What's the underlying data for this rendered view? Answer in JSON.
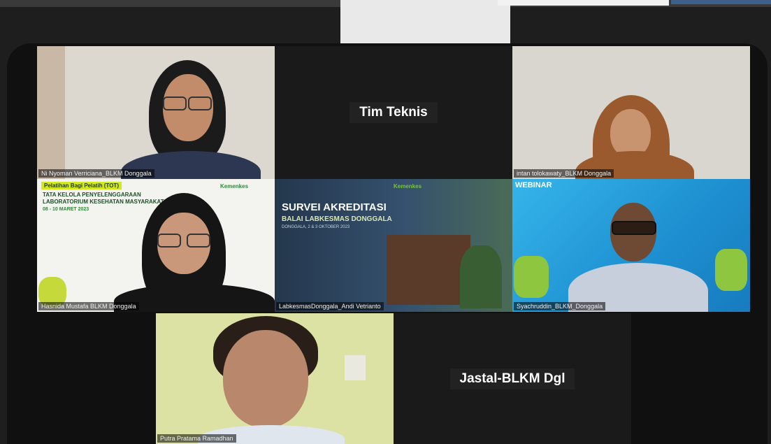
{
  "participants": [
    {
      "name": "Ni Nyoman Verriciana_BLKM Donggala"
    },
    {
      "name": "Tim Teknis"
    },
    {
      "name": "intan tolokawaty_BLKM Donggala"
    },
    {
      "name": "Hasnida Mustafa BLKM Donggala"
    },
    {
      "name": "LabkesmasDonggala_Andi Vetrianto"
    },
    {
      "name": "Syachruddin_BLKM_Donggala"
    },
    {
      "name": "Jastal-BLKM Dgl"
    },
    {
      "name": "Putra Pratama Ramadhan"
    }
  ],
  "slide_left": {
    "badge": "Pelatihan Bagi Pelatih (TOT)",
    "title1": "TATA KELOLA PENYELENGGARAAN",
    "title2": "LABORATORIUM KESEHATAN MASYARAKAT",
    "date": "08 - 10 MARET 2023",
    "logo": "Kemenkes"
  },
  "slide_center": {
    "title": "SURVEI AKREDITASI",
    "subtitle": "BALAI LABKESMAS DONGGALA",
    "date": "DONGGALA, 2 & 3 OKTOBER 2023",
    "logo": "Kemenkes"
  },
  "slide_right": {
    "title": "WEBINAR"
  },
  "colors": {
    "stage": "#101010",
    "tile_dark": "#2a2a2a",
    "accent_green": "#7ac143",
    "accent_blue": "#1e9ad6"
  }
}
